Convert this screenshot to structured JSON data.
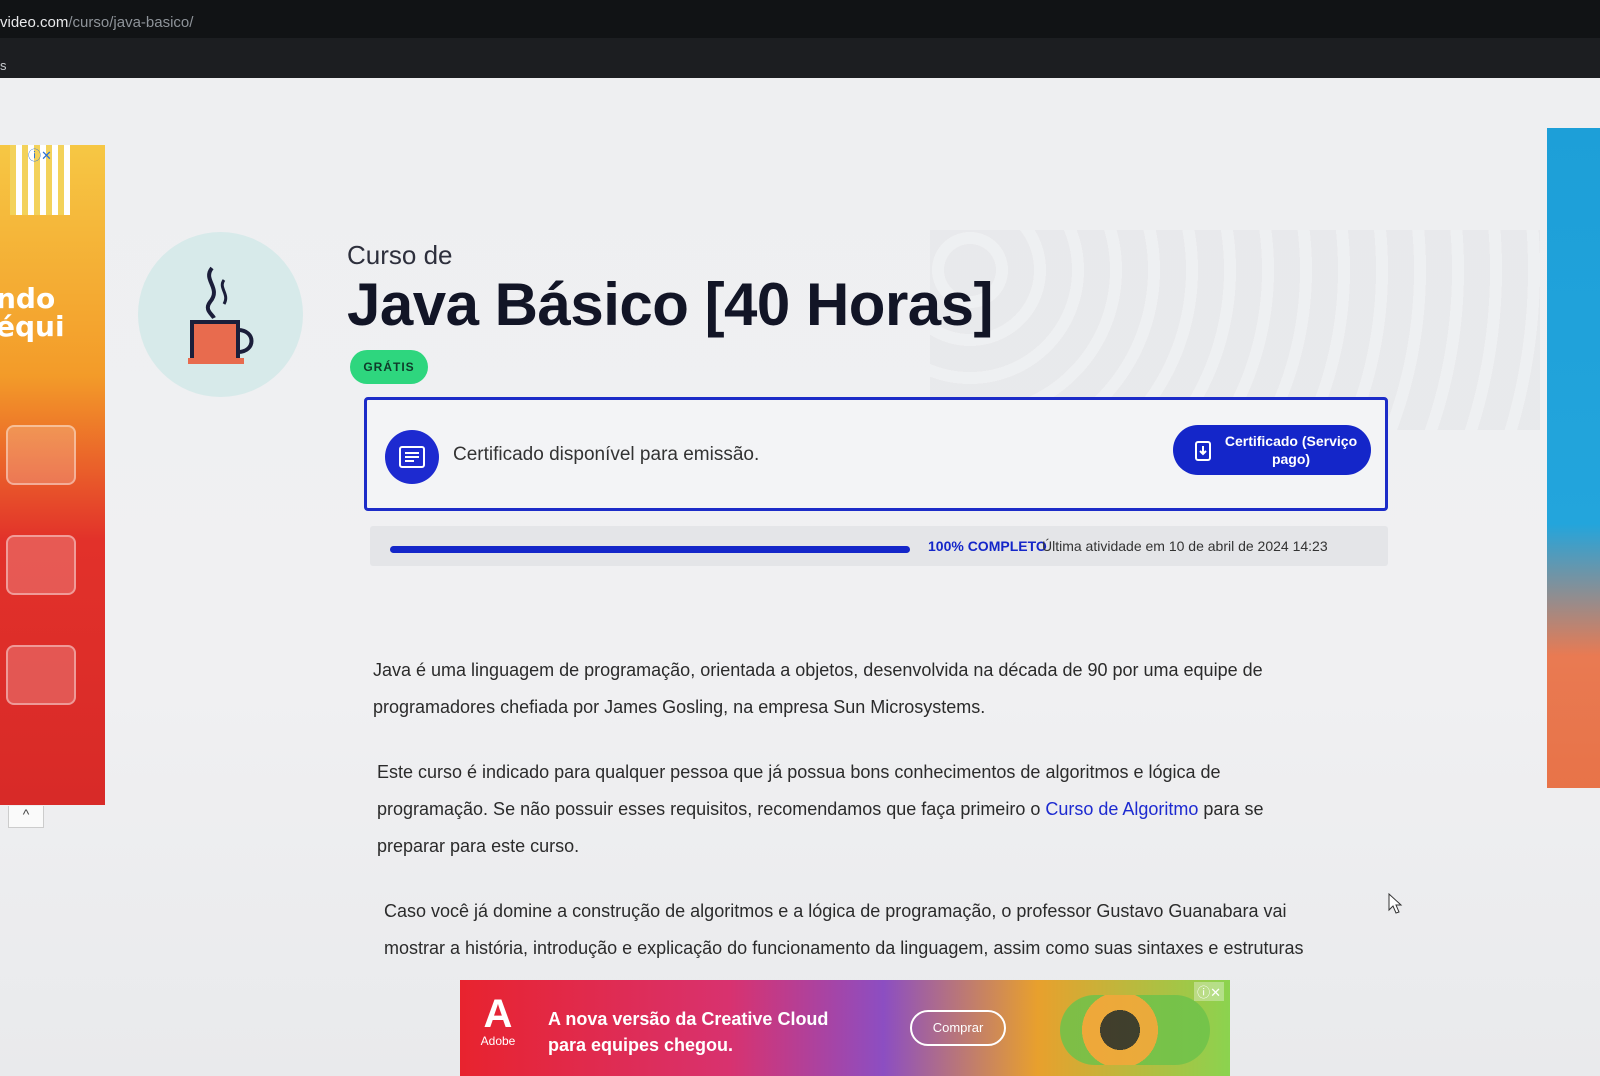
{
  "browser": {
    "url_host": "video.com",
    "url_path": "/curso/java-basico/",
    "bookmark_fragment": "s"
  },
  "left_ad": {
    "text_line1": "ndo",
    "text_line2": "équi"
  },
  "hero": {
    "kicker": "Curso de",
    "title": "Java Básico [40 Horas]",
    "badge": "GRÁTIS",
    "icon": "coffee-cup-icon"
  },
  "certificate": {
    "icon": "certificate-icon",
    "message": "Certificado disponível para emissão.",
    "button_label": "Certificado (Serviço pago)",
    "button_icon": "download-icon",
    "accent": "#1426c9"
  },
  "progress": {
    "percent": 100,
    "label": "100% COMPLETO",
    "last_activity": "Última atividade em 10 de abril de 2024 14:23"
  },
  "description": {
    "p1": "Java é uma linguagem de programação, orientada a objetos, desenvolvida na década de 90 por uma equipe de programadores chefiada por James Gosling, na empresa Sun Microsystems.",
    "p2_before": "Este curso é indicado para qualquer pessoa que já possua bons conhecimentos de algoritmos e lógica de programação. Se não possuir esses requisitos, recomendamos que faça primeiro o ",
    "p2_link": "Curso de Algoritmo",
    "p2_after": " para se preparar para este curso.",
    "p3": "Caso você já domine a construção de algoritmos e a lógica de programação, o professor Gustavo Guanabara vai mostrar a história, introdução e explicação do funcionamento da linguagem, assim como suas sintaxes e estruturas"
  },
  "bottom_ad": {
    "brand": "Adobe",
    "headline_line1": "A nova versão da Creative Cloud",
    "headline_line2": "para equipes chegou.",
    "button": "Comprar",
    "close": "ⓘ✕"
  },
  "ad_controls": {
    "info_close": "ⓘ✕",
    "collapse": "^"
  }
}
